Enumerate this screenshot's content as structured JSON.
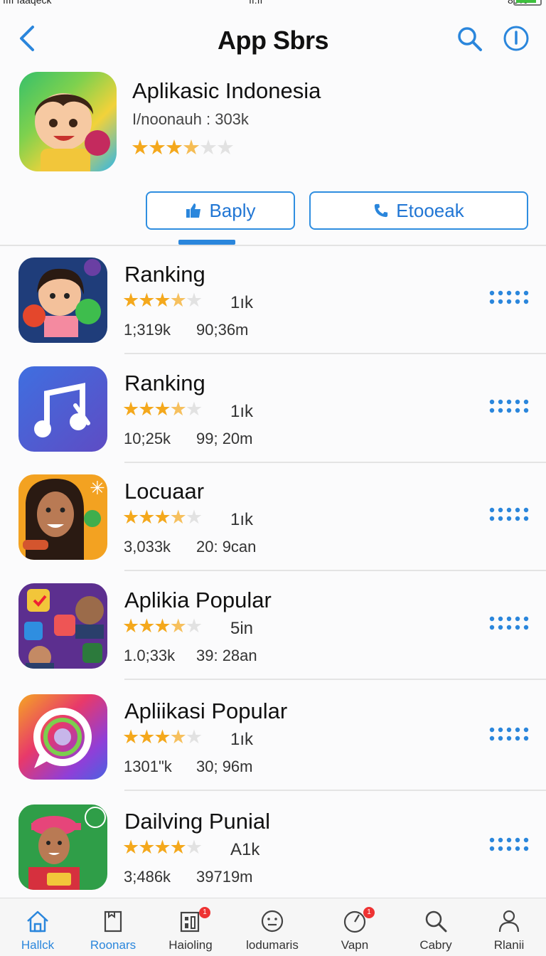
{
  "status_bar": {
    "carrier": "ıııı ıaaqeck",
    "time": "ıı:ıı",
    "battery": "80%"
  },
  "header": {
    "title": "App Sbrs"
  },
  "featured": {
    "title": "Aplikasic Indonesia",
    "subtitle": "I/noonauh : 303k",
    "rating": 3.5,
    "stars": "★★★★☆☆"
  },
  "actions": {
    "apply_label": "Baply",
    "call_label": "Etooeak"
  },
  "apps": [
    {
      "name": "Ranking",
      "rating": 3.5,
      "count": "1ık",
      "meta1": "1;319k",
      "meta2": "90;36m"
    },
    {
      "name": "Ranking",
      "rating": 3.5,
      "count": "1ık",
      "meta1": "10;25k",
      "meta2": "99; 20m"
    },
    {
      "name": "Locuaar",
      "rating": 3.5,
      "count": "1ık",
      "meta1": "3,033k",
      "meta2": "20: 9can"
    },
    {
      "name": "Aplikia Popular",
      "rating": 3.5,
      "count": "5in",
      "meta1": "1.0;33k",
      "meta2": "39: 28an"
    },
    {
      "name": "Apliikasi Popular",
      "rating": 3.5,
      "count": "1ık",
      "meta1": "1301\"k",
      "meta2": "30; 96m"
    },
    {
      "name": "Dailving Punial",
      "rating": 4.0,
      "count": "A1k",
      "meta1": "3;486k",
      "meta2": "39719m"
    }
  ],
  "nav": [
    {
      "label": "Hallck",
      "icon": "home-icon",
      "active": true
    },
    {
      "label": "Roonars",
      "icon": "document-icon",
      "active": true
    },
    {
      "label": "Haioling",
      "icon": "apps-icon",
      "badge": "1"
    },
    {
      "label": "lodumaris",
      "icon": "face-icon"
    },
    {
      "label": "Vapn",
      "icon": "gauge-icon",
      "badge": "1"
    },
    {
      "label": "Cabry",
      "icon": "search-icon"
    },
    {
      "label": "Rlanii",
      "icon": "person-icon"
    }
  ],
  "colors": {
    "accent": "#2a86dc",
    "star": "#f4a81c",
    "badge": "#e33333"
  }
}
